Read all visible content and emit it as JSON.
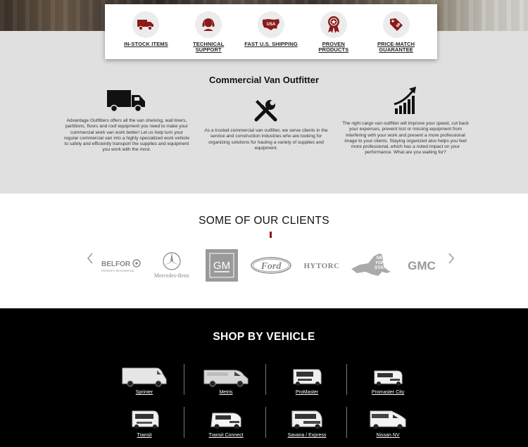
{
  "features": [
    {
      "icon": "delivery-truck-icon",
      "label": "IN-STOCK ITEMS"
    },
    {
      "icon": "headset-support-icon",
      "label": "TECHNICAL SUPPORT"
    },
    {
      "icon": "usa-map-icon",
      "label": "FAST U.S. SHIPPING"
    },
    {
      "icon": "award-ribbon-icon",
      "label": "PROVEN PRODUCTS"
    },
    {
      "icon": "price-tag-icon",
      "label": "PRICE-MATCH GUARANTEE"
    }
  ],
  "usa_badge_text": "USA",
  "outfitter": {
    "title": "Commercial Van Outfitter",
    "columns": [
      {
        "icon": "truck-icon",
        "text": "Advantage Outfitters offers all the van shelving, wall liners, partitions, floors and roof equipment you need to make your commercial work van work better! Let us help turn your regular commercial van into a highly specialized work vehicle to safely and efficiently transport the supplies and equipment you work with the most."
      },
      {
        "icon": "tools-icon",
        "text": "As a trusted commercial van outfitter, we serve clients in the service and construction industries who are looking for organizing solutions for hauling a variety of supplies and equipment."
      },
      {
        "icon": "growth-chart-icon",
        "text": "The right cargo van outfitter will improve your speed, cut back your expenses, prevent lost or missing equipment from interfering with your work and present a more professional image to your clients. Staying organized also helps you feel more professional, which has a noted impact on your performance. What are you waiting for?"
      }
    ]
  },
  "clients": {
    "title": "SOME OF OUR CLIENTS",
    "logos": {
      "belfor": "BELFOR",
      "belfor_sub": "PROPERTY RESTORATION",
      "mercedes": "Mercedes-Benz",
      "gm": "GM",
      "ford": "Ford",
      "hytorc": "HYTORC",
      "ny_line1": "NEW",
      "ny_line2": "YORK",
      "ny_line3": "STATE",
      "gmc": "GMC"
    }
  },
  "shop": {
    "title": "SHOP BY VEHICLE",
    "vehicles": [
      {
        "label": "Sprinter"
      },
      {
        "label": "Metris"
      },
      {
        "label": "ProMaster"
      },
      {
        "label": "Promaster City"
      },
      {
        "label": "Transit"
      },
      {
        "label": "Transit Connect"
      },
      {
        "label": "Savana / Express"
      },
      {
        "label": "Nissan NV"
      }
    ]
  },
  "colors": {
    "brand_red": "#8b1a1a",
    "gray_bg": "#e0e0e0",
    "black_bg": "#000000"
  }
}
